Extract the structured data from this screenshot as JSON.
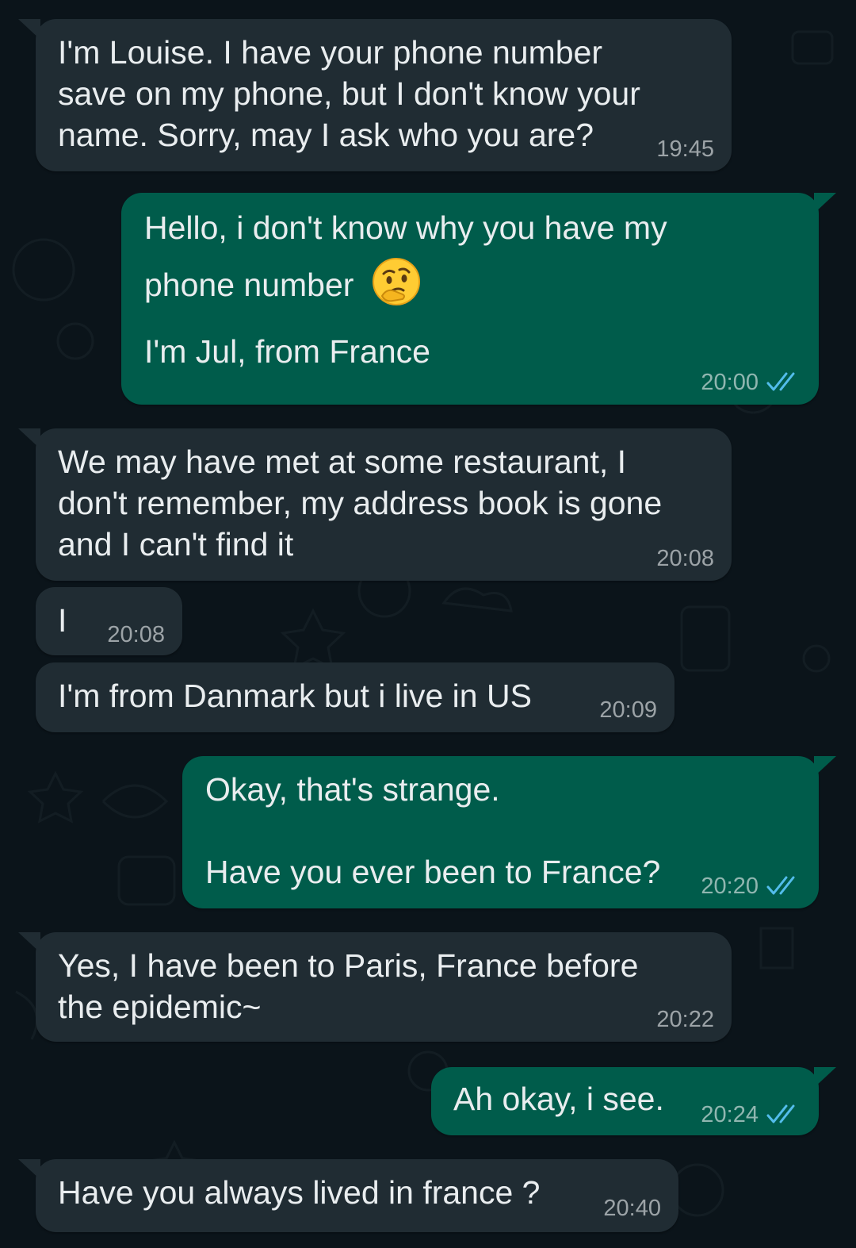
{
  "colors": {
    "wallpaper": "#0b141a",
    "incoming_bubble": "#202c33",
    "outgoing_bubble": "#005c4b",
    "read_ticks": "#53bdeb",
    "text": "#e9edef"
  },
  "messages": [
    {
      "direction": "incoming",
      "text": "I'm Louise. I have your phone number\nsave on my phone, but I don't know your\nname. Sorry, may I ask who you are?",
      "time": "19:45"
    },
    {
      "direction": "outgoing",
      "text_line1": "Hello, i don't know why you have my",
      "text_line2": "phone number",
      "emoji": "thinking-face",
      "text_line3": "I'm Jul, from France",
      "time": "20:00",
      "status": "read-double-tick-icon"
    },
    {
      "direction": "incoming",
      "text": "We may have met at some restaurant, I\ndon't remember, my address book is gone\nand I can't find it",
      "time": "20:08"
    },
    {
      "direction": "incoming",
      "text": "I",
      "time": "20:08"
    },
    {
      "direction": "incoming",
      "text": "I'm from Danmark but i live in US",
      "time": "20:09"
    },
    {
      "direction": "outgoing",
      "text": "Okay, that's strange.\n\nHave you ever been to France?",
      "time": "20:20",
      "status": "read-double-tick-icon"
    },
    {
      "direction": "incoming",
      "text": "Yes, I have been to Paris, France before\nthe epidemic~",
      "time": "20:22"
    },
    {
      "direction": "outgoing",
      "text": "Ah okay, i see.",
      "time": "20:24",
      "status": "read-double-tick-icon"
    },
    {
      "direction": "incoming",
      "text": "Have you always lived in france ?",
      "time": "20:40"
    }
  ]
}
